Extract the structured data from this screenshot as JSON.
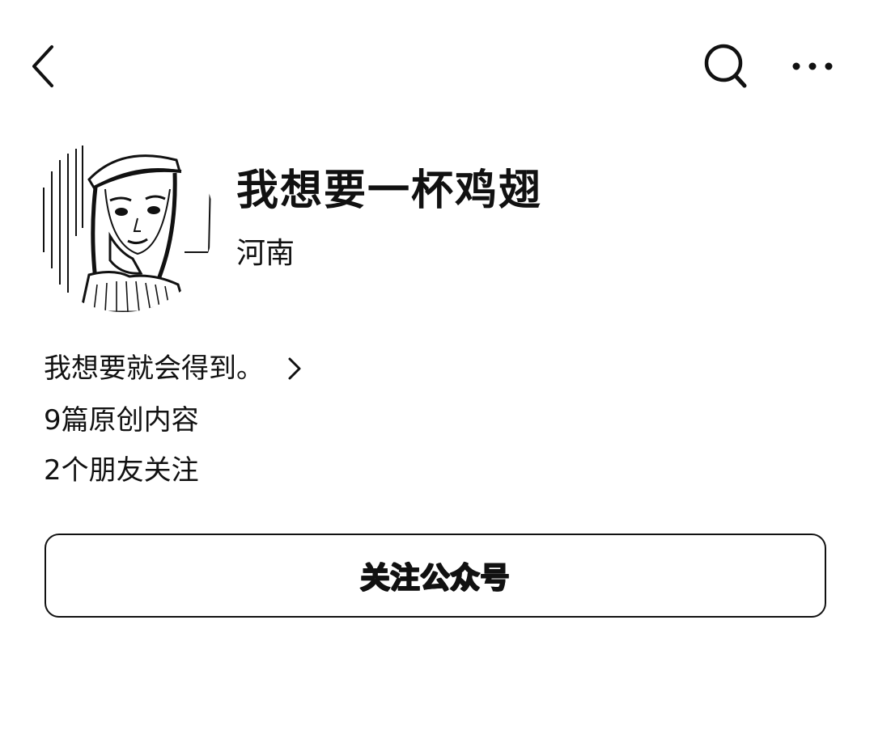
{
  "nav": {
    "back_icon": "chevron-left-icon",
    "search_icon": "search-icon",
    "more_icon": "more-dots-icon"
  },
  "profile": {
    "name": "我想要一杯鸡翅",
    "location": "河南",
    "avatar": "avatar"
  },
  "bio": {
    "text": "我想要就会得到。",
    "chevron_icon": "chevron-right-icon"
  },
  "stats": {
    "articles": "9篇原创内容",
    "followers": "2个朋友关注"
  },
  "actions": {
    "follow_label": "关注公众号"
  },
  "colors": {
    "text": "#111111",
    "background": "#ffffff",
    "button_border": "#111111"
  }
}
